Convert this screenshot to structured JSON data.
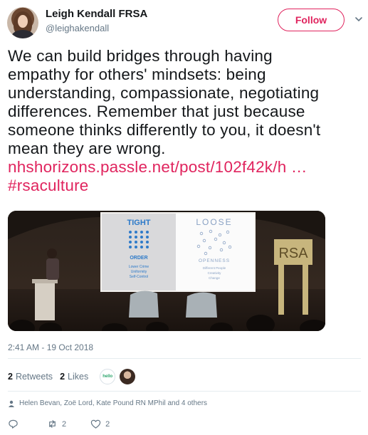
{
  "author": {
    "name": "Leigh Kendall FRSA",
    "handle": "@leighakendall"
  },
  "follow_label": "Follow",
  "tweet": {
    "lines": [
      "We can build bridges through having",
      "empathy for others' mindsets: being",
      "understanding, compassionate, negotiating",
      "differences. Remember that just because",
      "someone thinks differently to you, it doesn't",
      "mean they are wrong."
    ],
    "link": "nhshorizons.passle.net/post/102f42k/h …",
    "hashtag": "#rsaculture"
  },
  "media": {
    "slide_left_title": "TIGHT",
    "slide_left_subtitle": "ORDER",
    "slide_left_items": [
      "Lower Crime",
      "Uniformity",
      "Self-Control"
    ],
    "slide_right_title": "LOOSE",
    "slide_right_subtitle": "OPENNESS",
    "slide_right_items": [
      "Different People",
      "Creativity",
      "Change"
    ],
    "sign_text": "RSA"
  },
  "timestamp": "2:41 AM - 19 Oct 2018",
  "stats": {
    "retweets_count": "2",
    "retweets_label": "Retweets",
    "likes_count": "2",
    "likes_label": "Likes",
    "hello_badge": "hello"
  },
  "likers": "Helen Bevan, Zoë Lord, Kate Pound RN MPhil and 4 others",
  "actions": {
    "reply": "",
    "retweet_count": "2",
    "like_count": "2"
  },
  "colors": {
    "accent": "#e0245e",
    "muted": "#657786",
    "text": "#14171a"
  }
}
